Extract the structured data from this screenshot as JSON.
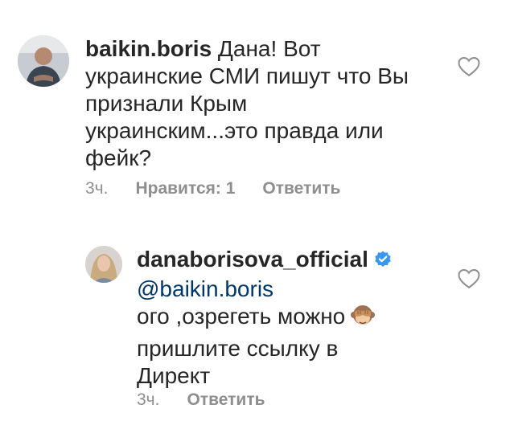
{
  "comment1": {
    "username": "baikin.boris",
    "text": " Дана! Вот",
    "lines": [
      "украинские СМИ пишут что Вы",
      "признали Крым",
      "украинским...это правда или",
      "фейк?"
    ],
    "time": "3ч.",
    "likes": "Нравится: 1",
    "reply": "Ответить",
    "icons": {
      "like": "heart-outline-icon"
    }
  },
  "comment2": {
    "username": "danaborisova_official",
    "mention": "@baikin.boris",
    "lines": [
      "ого ,озрегеть можно",
      "пришлите ссылку в",
      "Директ"
    ],
    "emoji": "see-no-evil-monkey-emoji",
    "time": "3ч.",
    "reply": "Ответить",
    "verified": true,
    "icons": {
      "like": "heart-outline-icon",
      "verified": "verified-badge-icon"
    }
  },
  "colors": {
    "text": "#262626",
    "meta": "#8e8e8e",
    "mention": "#00376b",
    "verified": "#3897f0"
  }
}
